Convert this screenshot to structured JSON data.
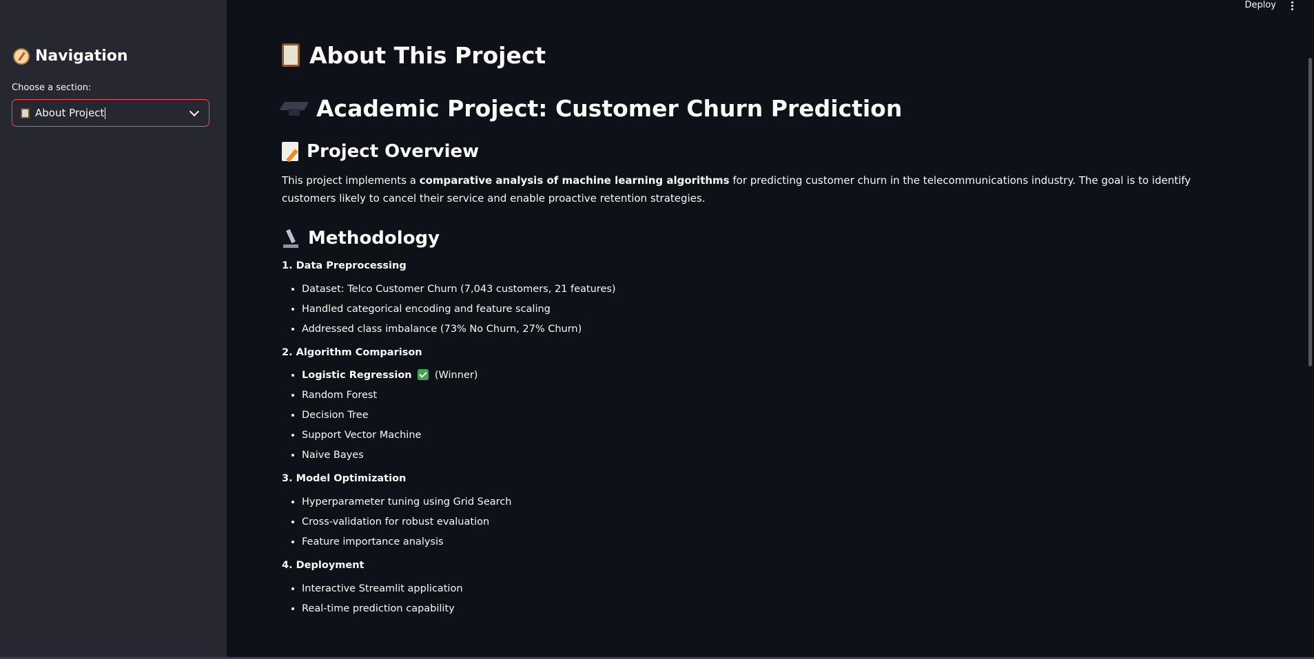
{
  "header": {
    "deploy_label": "Deploy"
  },
  "sidebar": {
    "title": "Navigation",
    "select_label": "Choose a section:",
    "select_value": "About Project"
  },
  "main": {
    "title": "About This Project",
    "project_title": "Academic Project: Customer Churn Prediction",
    "overview": {
      "heading": "Project Overview",
      "text_before": "This project implements a ",
      "text_bold": "comparative analysis of machine learning algorithms",
      "text_after": " for predicting customer churn in the telecommunications industry. The goal is to identify customers likely to cancel their service and enable proactive retention strategies."
    },
    "methodology": {
      "heading": "Methodology",
      "sections": [
        {
          "title": "1. Data Preprocessing",
          "items": [
            "Dataset: Telco Customer Churn (7,043 customers, 21 features)",
            "Handled categorical encoding and feature scaling",
            "Addressed class imbalance (73% No Churn, 27% Churn)"
          ]
        },
        {
          "title": "2. Algorithm Comparison",
          "winner_name": "Logistic Regression",
          "winner_suffix": "(Winner)",
          "items": [
            "Random Forest",
            "Decision Tree",
            "Support Vector Machine",
            "Naive Bayes"
          ]
        },
        {
          "title": "3. Model Optimization",
          "items": [
            "Hyperparameter tuning using Grid Search",
            "Cross-validation for robust evaluation",
            "Feature importance analysis"
          ]
        },
        {
          "title": "4. Deployment",
          "items": [
            "Interactive Streamlit application",
            "Real-time prediction capability"
          ]
        }
      ]
    }
  }
}
